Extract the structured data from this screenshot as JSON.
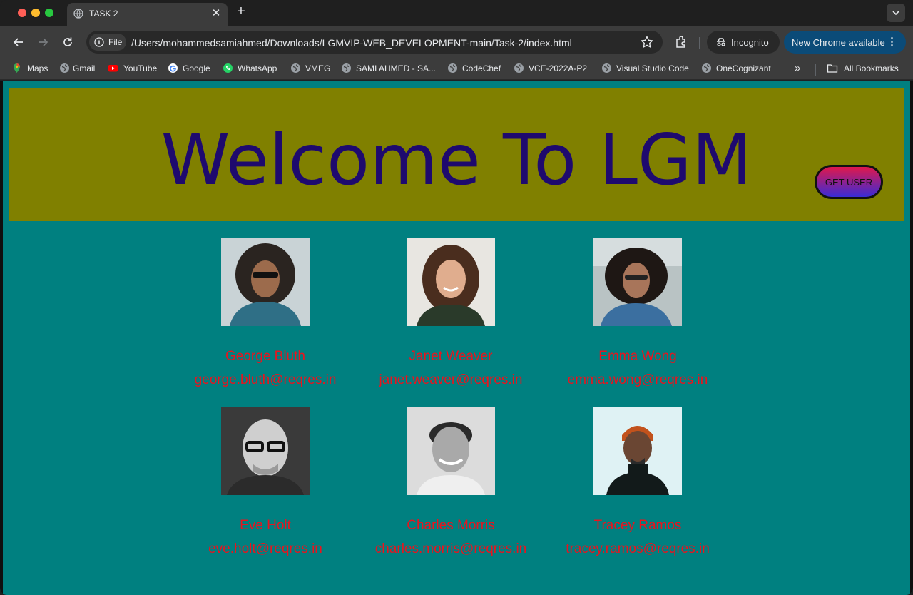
{
  "browser": {
    "tab_title": "TASK 2",
    "omnibox_chip": "File",
    "url": "/Users/mohammedsamiahmed/Downloads/LGMVIP-WEB_DEVELOPMENT-main/Task-2/index.html",
    "incognito_label": "Incognito",
    "update_label": "New Chrome available",
    "bookmarks": [
      {
        "label": "Maps",
        "icon": "maps-icon"
      },
      {
        "label": "Gmail",
        "icon": "globe-icon"
      },
      {
        "label": "YouTube",
        "icon": "youtube-icon"
      },
      {
        "label": "Google",
        "icon": "google-icon"
      },
      {
        "label": "WhatsApp",
        "icon": "whatsapp-icon"
      },
      {
        "label": "VMEG",
        "icon": "globe-icon"
      },
      {
        "label": "SAMI AHMED - SA...",
        "icon": "globe-icon"
      },
      {
        "label": "CodeChef",
        "icon": "globe-icon"
      },
      {
        "label": "VCE-2022A-P2",
        "icon": "globe-icon"
      },
      {
        "label": "Visual Studio Code",
        "icon": "globe-icon"
      },
      {
        "label": "OneCognizant",
        "icon": "globe-icon"
      }
    ],
    "all_bookmarks_label": "All Bookmarks"
  },
  "page": {
    "heading": "Welcome To LGM",
    "button_label": "GET USER",
    "colors": {
      "page_bg": "#008080",
      "header_bg": "#808000",
      "heading": "#1e0a6e",
      "user_text": "#e8141e"
    },
    "users": [
      {
        "name": "George Bluth",
        "email": "george.bluth@reqres.in"
      },
      {
        "name": "Janet Weaver",
        "email": "janet.weaver@reqres.in"
      },
      {
        "name": "Emma Wong",
        "email": "emma.wong@reqres.in"
      },
      {
        "name": "Eve Holt",
        "email": "eve.holt@reqres.in"
      },
      {
        "name": "Charles Morris",
        "email": "charles.morris@reqres.in"
      },
      {
        "name": "Tracey Ramos",
        "email": "tracey.ramos@reqres.in"
      }
    ]
  }
}
